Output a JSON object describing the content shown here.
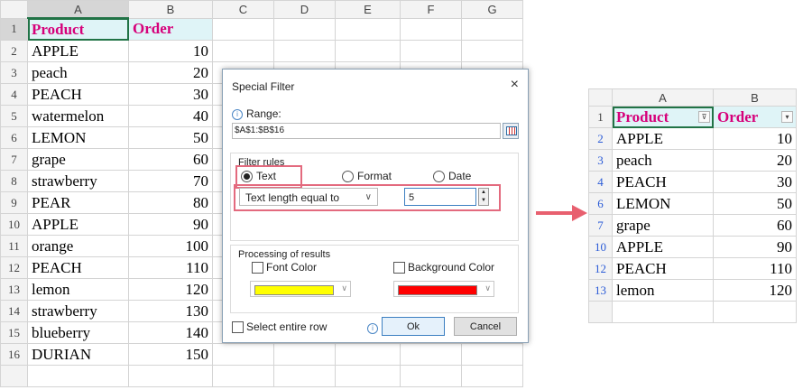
{
  "left_sheet": {
    "col_headers": [
      "",
      "A",
      "B",
      "C",
      "D",
      "E",
      "F",
      "G"
    ],
    "header_row": {
      "row": "1",
      "a": "Product",
      "b": "Order"
    },
    "rows": [
      {
        "row": "2",
        "a": "APPLE",
        "b": "10"
      },
      {
        "row": "3",
        "a": "peach",
        "b": "20"
      },
      {
        "row": "4",
        "a": "PEACH",
        "b": "30"
      },
      {
        "row": "5",
        "a": "watermelon",
        "b": "40"
      },
      {
        "row": "6",
        "a": "LEMON",
        "b": "50"
      },
      {
        "row": "7",
        "a": "grape",
        "b": "60"
      },
      {
        "row": "8",
        "a": "strawberry",
        "b": "70"
      },
      {
        "row": "9",
        "a": "PEAR",
        "b": "80"
      },
      {
        "row": "10",
        "a": "APPLE",
        "b": "90"
      },
      {
        "row": "11",
        "a": "orange",
        "b": "100"
      },
      {
        "row": "12",
        "a": "PEACH",
        "b": "110"
      },
      {
        "row": "13",
        "a": "lemon",
        "b": "120"
      },
      {
        "row": "14",
        "a": "strawberry",
        "b": "130"
      },
      {
        "row": "15",
        "a": "blueberry",
        "b": "140"
      },
      {
        "row": "16",
        "a": "DURIAN",
        "b": "150"
      }
    ]
  },
  "dialog": {
    "title": "Special Filter",
    "close_icon": "×",
    "info_icon": "i",
    "range_label": "Range:",
    "range_value": "$A$1:$B$16",
    "filter_rules_label": "Filter rules",
    "radio_text": "Text",
    "radio_format": "Format",
    "radio_date": "Date",
    "text_rule_value": "Text length equal to",
    "combo_arrow": "∨",
    "length_value": "5",
    "spin_up": "▲",
    "spin_down": "▼",
    "processing_label": "Processing of results",
    "font_color_label": "Font Color",
    "font_color_value": "#ffff00",
    "background_color_label": "Background Color",
    "background_color_value": "#ff0000",
    "select_entire_row_label": "Select entire row",
    "ok_label": "Ok",
    "cancel_label": "Cancel"
  },
  "arrow_color": "#e8606f",
  "right_sheet": {
    "col_headers": [
      "",
      "A",
      "B"
    ],
    "header_row": {
      "row": "1",
      "a": "Product",
      "b": "Order"
    },
    "filter_icon_product": "⊽",
    "filter_icon_order": "▾",
    "rows": [
      {
        "row": "2",
        "a": "APPLE",
        "b": "10"
      },
      {
        "row": "3",
        "a": "peach",
        "b": "20"
      },
      {
        "row": "4",
        "a": "PEACH",
        "b": "30"
      },
      {
        "row": "6",
        "a": "LEMON",
        "b": "50"
      },
      {
        "row": "7",
        "a": "grape",
        "b": "60"
      },
      {
        "row": "10",
        "a": "APPLE",
        "b": "90"
      },
      {
        "row": "12",
        "a": "PEACH",
        "b": "110"
      },
      {
        "row": "13",
        "a": "lemon",
        "b": "120"
      }
    ]
  }
}
